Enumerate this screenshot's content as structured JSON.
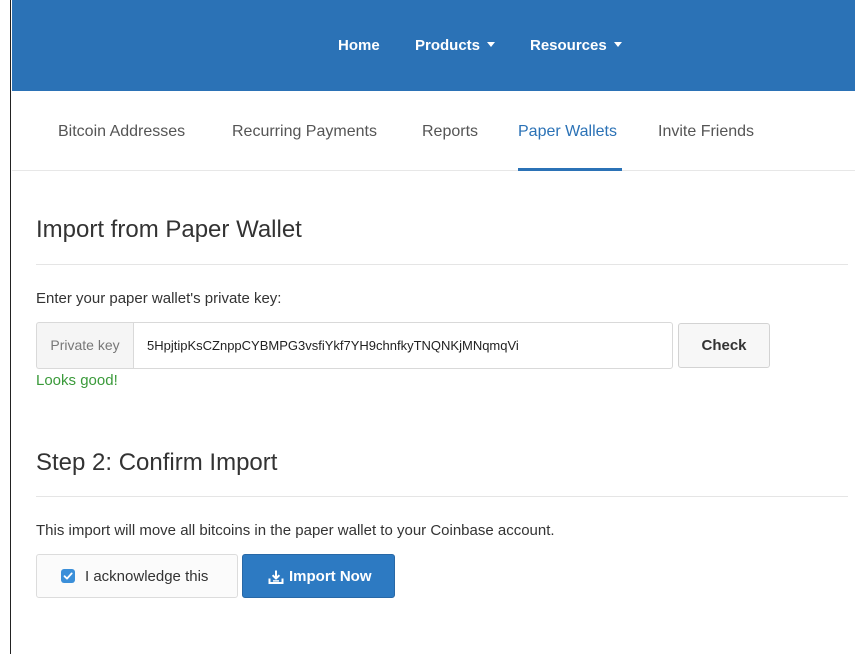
{
  "colors": {
    "brand": "#2b72b6",
    "success": "#3a9a3a",
    "primary_button": "#2d7ac2"
  },
  "topnav": {
    "home": "Home",
    "products": "Products",
    "resources": "Resources"
  },
  "tabs": [
    {
      "label": "Bitcoin Addresses",
      "active": false
    },
    {
      "label": "Recurring Payments",
      "active": false
    },
    {
      "label": "Reports",
      "active": false
    },
    {
      "label": "Paper Wallets",
      "active": true
    },
    {
      "label": "Invite Friends",
      "active": false
    }
  ],
  "import": {
    "title": "Import from Paper Wallet",
    "prompt": "Enter your paper wallet's private key:",
    "addon_label": "Private key",
    "private_key_value": "5HpjtipKsCZnppCYBMPG3vsfiYkf7YH9chnfkyTNQNKjMNqmqVi",
    "check_label": "Check",
    "status": "Looks good!"
  },
  "confirm": {
    "title": "Step 2: Confirm Import",
    "description": "This import will move all bitcoins in the paper wallet to your Coinbase account.",
    "acknowledge_label": "I acknowledge this",
    "acknowledge_checked": true,
    "import_label": "Import Now",
    "import_icon": "download-icon"
  }
}
